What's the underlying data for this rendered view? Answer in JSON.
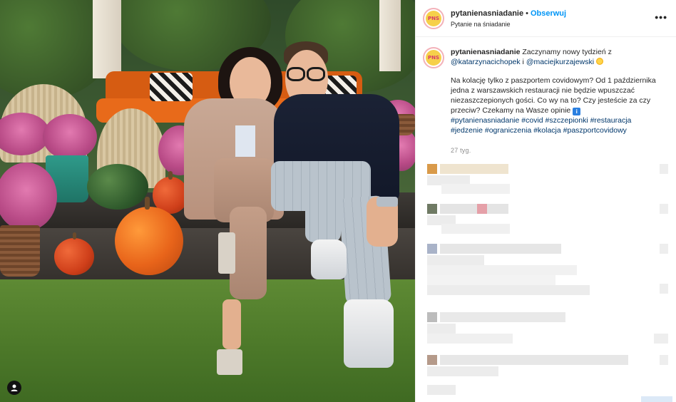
{
  "post": {
    "username": "pytanienasniadanie",
    "follow_label": "Obserwuj",
    "location": "Pytanie na śniadanie",
    "more_label": "•••",
    "avatar_text": "PNS"
  },
  "caption": {
    "username": "pytanienasniadanie",
    "line1": "Zaczynamy nowy tydzień z",
    "mention1": "@katarzynacichopek",
    "and": "i",
    "mention2": "@maciejkurzajewski",
    "paragraph2": "Na kolację tylko z paszportem covidowym? Od 1 października jedna z warszawskich restauracji nie będzie wpuszczać niezaszczepionych gości. Co wy na to? Czy jesteście za czy przeciw? Czekamy na Wasze opinie",
    "info_emoji": "i",
    "hashtags": [
      "#pytanienasniadanie",
      "#covid",
      "#szczepionki",
      "#restauracja",
      "#jedzenie",
      "#ograniczenia",
      "#kolacja",
      "#paszportcovidowy"
    ],
    "timestamp": "27 tyg."
  },
  "photo": {
    "user_tag_icon": "person-icon"
  },
  "colors": {
    "link": "#00376b",
    "follow": "#0095f6",
    "muted": "#8e8e8e"
  }
}
